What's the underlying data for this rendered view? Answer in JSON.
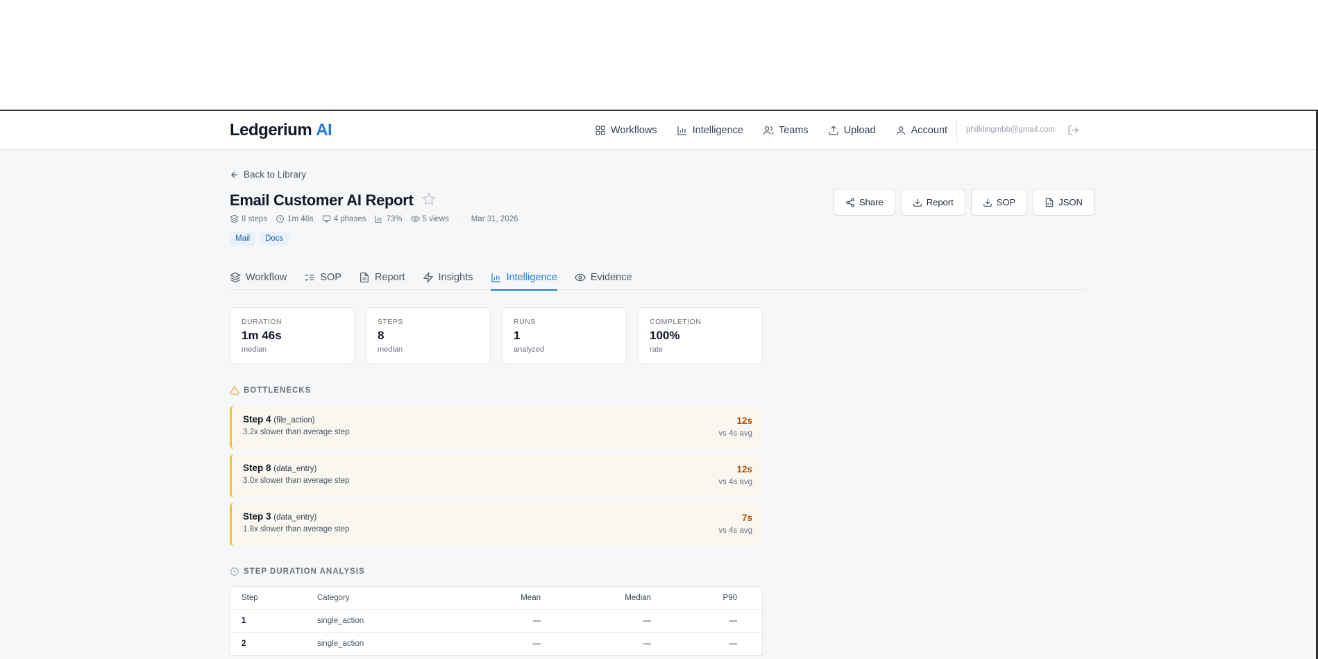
{
  "app": {
    "logo_main": "Ledgerium",
    "logo_accent": "AI"
  },
  "nav": {
    "links": [
      {
        "label": "Workflows",
        "icon": "grid-icon"
      },
      {
        "label": "Intelligence",
        "icon": "bar-chart-icon"
      },
      {
        "label": "Teams",
        "icon": "users-icon"
      },
      {
        "label": "Upload",
        "icon": "upload-icon"
      },
      {
        "label": "Account",
        "icon": "user-icon"
      }
    ],
    "email": "philklingmbb@gmail.com",
    "logout_icon": "logout-icon"
  },
  "page": {
    "back_label": "Back to Library",
    "title": "Email Customer AI Report",
    "meta": {
      "steps": "8 steps",
      "duration": "1m 46s",
      "phases": "4 phases",
      "completion": "73%",
      "views": "5 views",
      "separator": "·",
      "date": "Mar 31, 2026"
    },
    "tags": [
      "Mail",
      "Docs"
    ],
    "actions": {
      "share": "Share",
      "report": "Report",
      "sop": "SOP",
      "json": "JSON"
    }
  },
  "tabs": [
    {
      "label": "Workflow",
      "active": false
    },
    {
      "label": "SOP",
      "active": false
    },
    {
      "label": "Report",
      "active": false
    },
    {
      "label": "Insights",
      "active": false
    },
    {
      "label": "Intelligence",
      "active": true
    },
    {
      "label": "Evidence",
      "active": false
    }
  ],
  "stats": [
    {
      "label": "DURATION",
      "value": "1m 46s",
      "sub": "median"
    },
    {
      "label": "STEPS",
      "value": "8",
      "sub": "median"
    },
    {
      "label": "RUNS",
      "value": "1",
      "sub": "analyzed"
    },
    {
      "label": "COMPLETION",
      "value": "100%",
      "sub": "rate"
    }
  ],
  "bottlenecks": {
    "heading": "BOTTLENECKS",
    "items": [
      {
        "step": "Step 4",
        "category": "(file_action)",
        "desc": "3.2x slower than average step",
        "value": "12s",
        "avg": "vs 4s avg"
      },
      {
        "step": "Step 8",
        "category": "(data_entry)",
        "desc": "3.0x slower than average step",
        "value": "12s",
        "avg": "vs 4s avg"
      },
      {
        "step": "Step 3",
        "category": "(data_entry)",
        "desc": "1.8x slower than average step",
        "value": "7s",
        "avg": "vs 4s avg"
      }
    ]
  },
  "duration_analysis": {
    "heading": "STEP DURATION ANALYSIS",
    "columns": [
      "Step",
      "Category",
      "Mean",
      "Median",
      "P90"
    ],
    "rows": [
      {
        "step": "1",
        "category": "single_action",
        "mean": "—",
        "median": "—",
        "p90": "—"
      },
      {
        "step": "2",
        "category": "single_action",
        "mean": "—",
        "median": "—",
        "p90": "—"
      }
    ]
  },
  "colors": {
    "accent": "#1f7bd0",
    "bottleneck_border": "#f2c230",
    "bottleneck_value": "#b45309",
    "warning_icon": "#e0a614"
  }
}
